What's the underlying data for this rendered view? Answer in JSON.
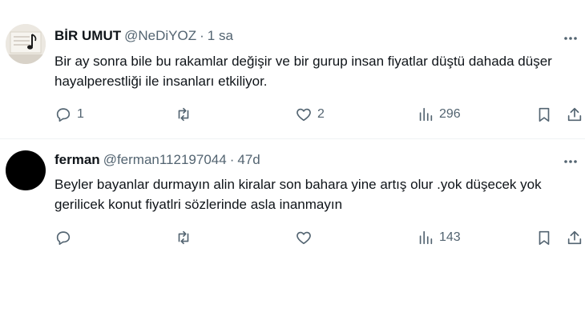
{
  "tweets": [
    {
      "display_name": "BİR UMUT",
      "handle": "@NeDiYOZ",
      "dot": "·",
      "time": "1 sa",
      "text": "Bir ay sonra bile bu rakamlar değişir ve bir gurup insan fiyatlar düştü dahada düşer hayalperestliği ile insanları etkiliyor.",
      "replies": "1",
      "retweets": "",
      "likes": "2",
      "views": "296"
    },
    {
      "display_name": "ferman",
      "handle": "@ferman112197044",
      "dot": "·",
      "time": "47d",
      "text": "Beyler bayanlar durmayın alin kiralar son bahara yine artış olur .yok düşecek yok gerilicek konut fiyatlri sözlerinde asla inanmayın",
      "replies": "",
      "retweets": "",
      "likes": "",
      "views": "143"
    }
  ],
  "colors": {
    "text": "#0f1419",
    "secondary": "#536471",
    "divider": "#eff3f4"
  },
  "icons": [
    "more-icon",
    "reply-icon",
    "retweet-icon",
    "like-icon",
    "views-icon",
    "bookmark-icon",
    "share-icon"
  ]
}
